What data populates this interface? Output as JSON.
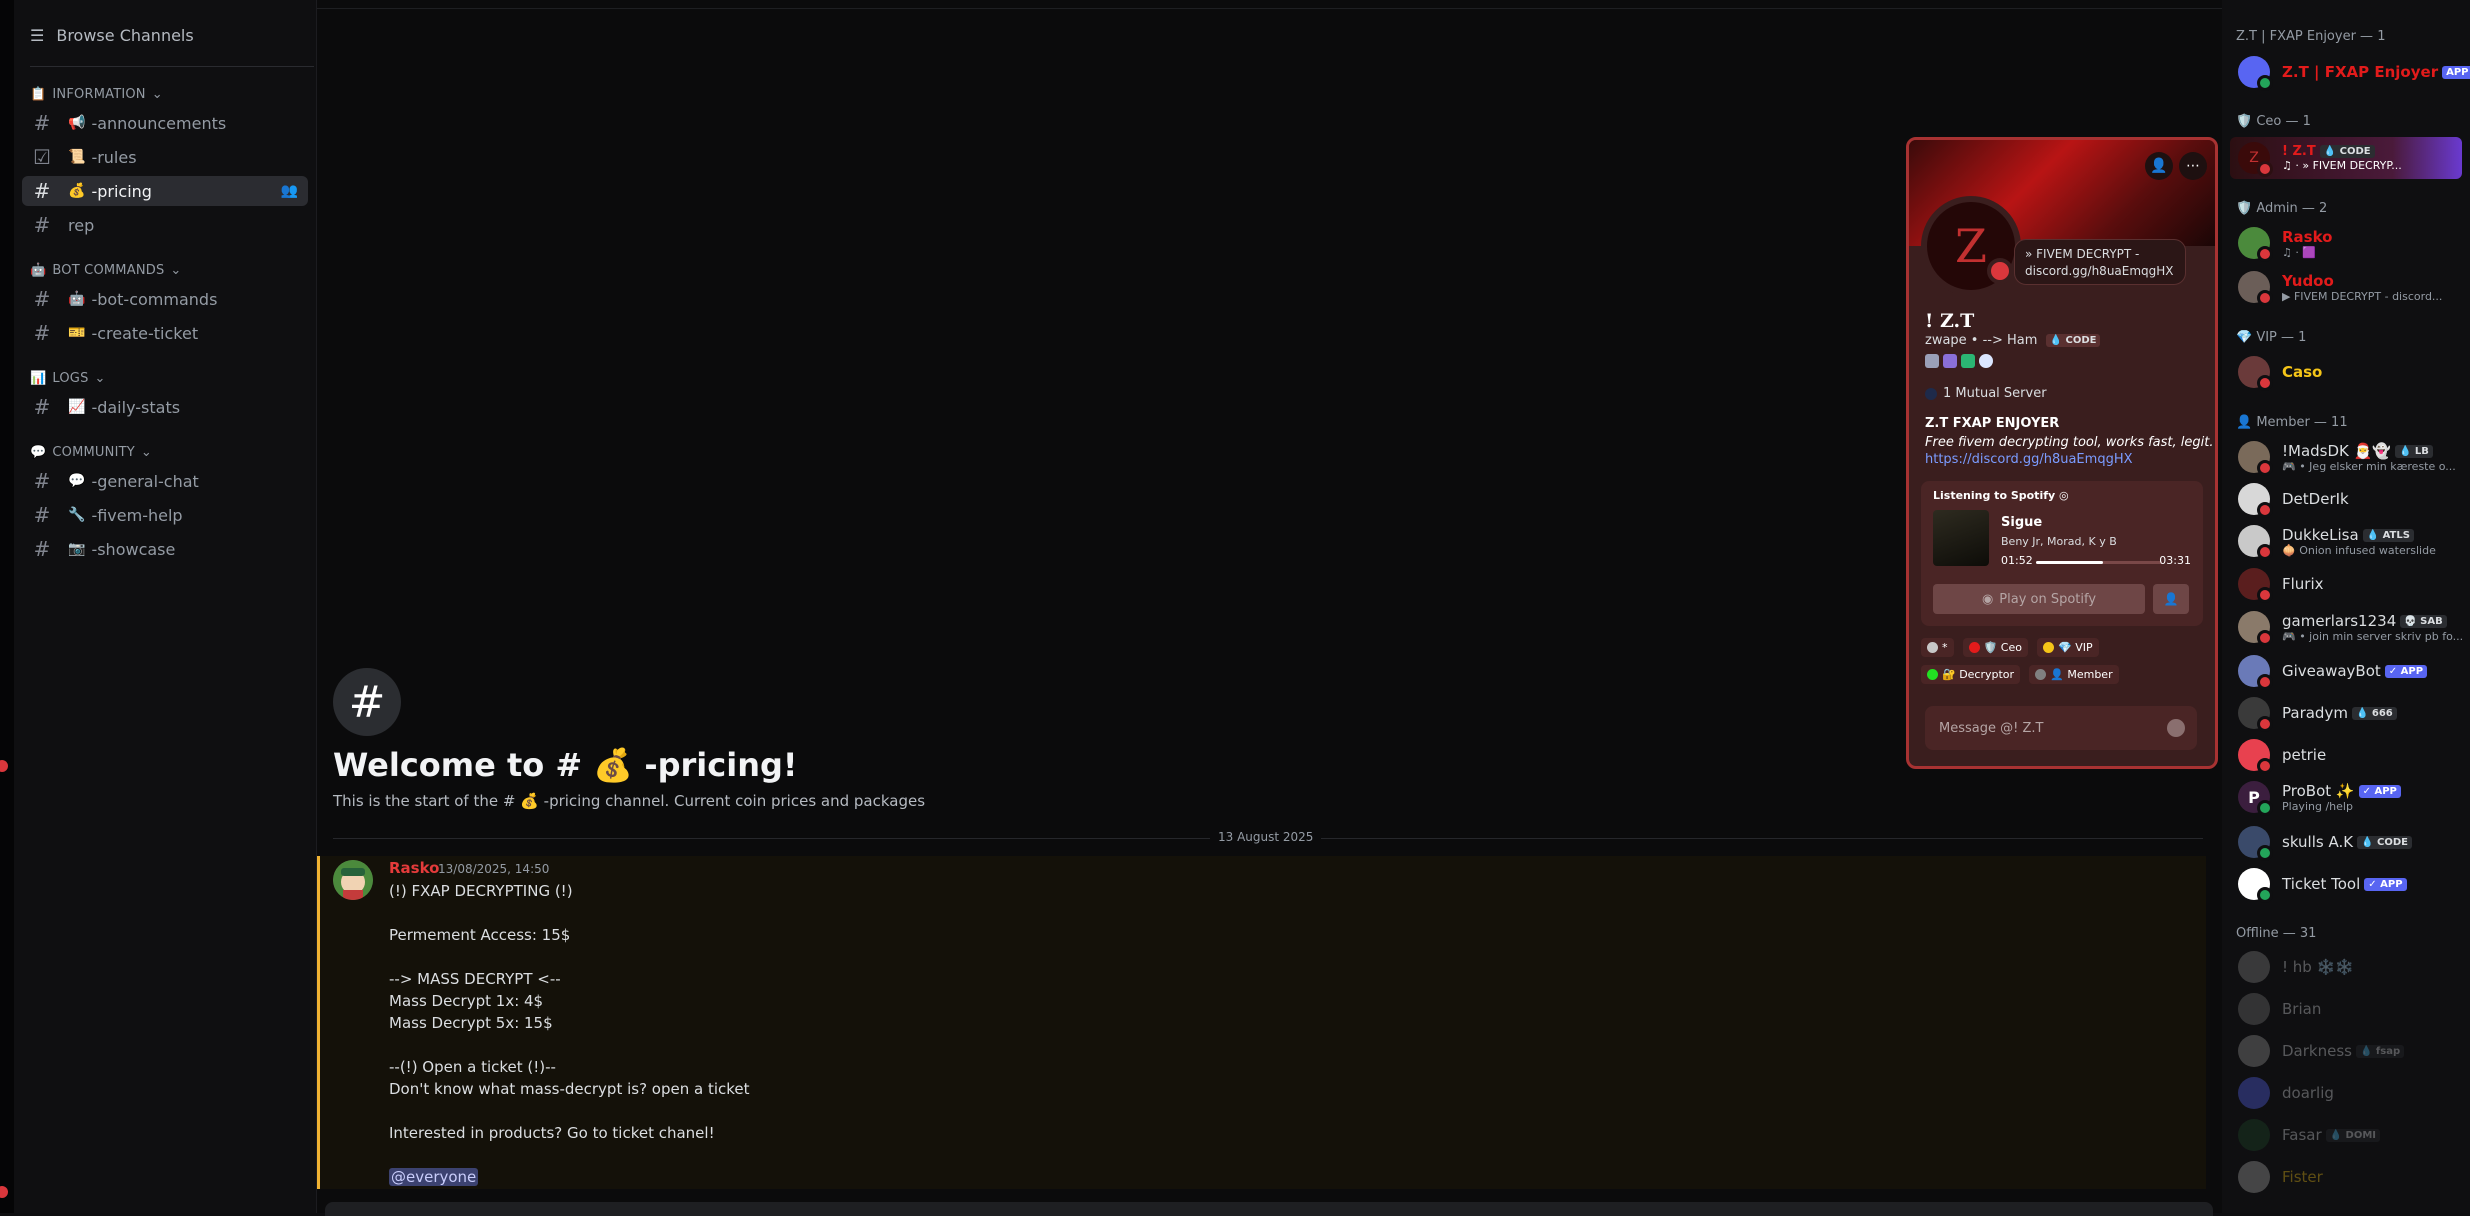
{
  "channel_sidebar": {
    "browse_label": "Browse Channels",
    "categories": [
      {
        "name": "INFORMATION",
        "emoji": "📋"
      },
      {
        "name": "BOT COMMANDS",
        "emoji": "🤖"
      },
      {
        "name": "LOGS",
        "emoji": "📊"
      },
      {
        "name": "COMMUNITY",
        "emoji": "💬"
      }
    ],
    "channels": [
      {
        "emoji": "📢",
        "name": "-announcements"
      },
      {
        "emoji": "📜",
        "name": "-rules"
      },
      {
        "emoji": "💰",
        "name": "-pricing"
      },
      {
        "emoji": "",
        "name": "rep"
      },
      {
        "emoji": "🤖",
        "name": "-bot-commands"
      },
      {
        "emoji": "🎫",
        "name": "-create-ticket"
      },
      {
        "emoji": "📈",
        "name": "-daily-stats"
      },
      {
        "emoji": "💬",
        "name": "-general-chat"
      },
      {
        "emoji": "🔧",
        "name": "-fivem-help"
      },
      {
        "emoji": "📷",
        "name": "-showcase"
      }
    ]
  },
  "main": {
    "welcome_title": "Welcome to # 💰 -pricing!",
    "welcome_sub": "This is the start of the # 💰 -pricing channel. Current coin prices and packages",
    "date_divider": "13 August 2025",
    "message": {
      "author": "Rasko",
      "timestamp": "13/08/2025, 14:50",
      "lines": [
        "(!) FXAP DECRYPTING (!)",
        "",
        "Permement Access: 15$",
        "",
        "--> MASS DECRYPT <--",
        "Mass Decrypt 1x: 4$",
        "Mass Decrypt 5x: 15$",
        "",
        "--(!) Open a ticket (!)--",
        "Don't know what mass-decrypt is? open a ticket",
        "",
        "Interested in products? Go to ticket chanel!",
        ""
      ],
      "mention": "@everyone"
    }
  },
  "profile": {
    "avatar_letter": "Z",
    "status_bubble": "» FIVEM DECRYPT - discord.gg/h8uaEmqgHX",
    "display_name": "! Z.T",
    "username": "zwape • --> Ham",
    "code_tag": "💧 CODE",
    "mutual": "1 Mutual Server",
    "bio_title": "Z.T FXAP ENJOYER",
    "bio": "Free fivem decrypting tool, works fast, legit.",
    "link": "https://discord.gg/h8uaEmqgHX",
    "spotify": {
      "header": "Listening to Spotify",
      "song": "Sigue",
      "artist": "Beny Jr, Morad, K y B",
      "elapsed": "01:52",
      "total": "03:31",
      "progress": 0.53,
      "play_label": "Play on Spotify"
    },
    "roles": [
      {
        "name": "*",
        "color": "#c7c7c7"
      },
      {
        "name": "🛡️ Ceo",
        "color": "#e21b1b"
      },
      {
        "name": "💎 VIP",
        "color": "#f5c518"
      },
      {
        "name": "🔐 Decryptor",
        "color": "#22e022"
      },
      {
        "name": "👤 Member",
        "color": "#808080"
      }
    ],
    "message_placeholder": "Message @! Z.T"
  },
  "members": {
    "groups": [
      {
        "label": "Z.T | FXAP Enjoyer — 1"
      },
      {
        "label": "🛡️ Ceo — 1"
      },
      {
        "label": "🛡️ Admin — 2"
      },
      {
        "label": "💎 VIP — 1"
      },
      {
        "label": "👤 Member — 11"
      },
      {
        "label": "Offline — 31"
      }
    ],
    "list": [
      {
        "name": "Z.T | FXAP Enjoyer",
        "sub": "",
        "badge": "APP",
        "color": "#e21b1b"
      },
      {
        "name": "! Z.T",
        "sub": "♫ · » FIVEM DECRYP...",
        "badge": "💧 CODE",
        "color": "#e21b1b"
      },
      {
        "name": "Rasko",
        "sub": "♫ · 🟪",
        "badge": "",
        "color": "#e21b1b"
      },
      {
        "name": "Yudoo",
        "sub": "▶ FIVEM DECRYPT - discord...",
        "badge": "",
        "color": "#e21b1b"
      },
      {
        "name": "Caso",
        "sub": "",
        "badge": "",
        "color": "#f5c518"
      },
      {
        "name": "!MadsDK 🎅👻",
        "sub": "🎮 • Jeg elsker min kæreste o...",
        "badge": "💧 LB",
        "color": "#dbdee1"
      },
      {
        "name": "DetDerIk",
        "sub": "",
        "badge": "",
        "color": "#dbdee1"
      },
      {
        "name": "DukkeLisa",
        "sub": "🧅 Onion infused waterslide",
        "badge": "💧 ATLS",
        "color": "#dbdee1"
      },
      {
        "name": "Flurix",
        "sub": "",
        "badge": "",
        "color": "#dbdee1"
      },
      {
        "name": "gamerlars1234",
        "sub": "🎮 • join min server skriv pb fo...",
        "badge": "💀 SAB",
        "color": "#dbdee1"
      },
      {
        "name": "GiveawayBot",
        "sub": "",
        "badge": "✓ APP",
        "color": "#dbdee1"
      },
      {
        "name": "Paradym",
        "sub": "",
        "badge": "💧 666",
        "color": "#dbdee1"
      },
      {
        "name": "petrie",
        "sub": "",
        "badge": "",
        "color": "#dbdee1"
      },
      {
        "name": "ProBot ✨",
        "sub": "Playing /help",
        "badge": "✓ APP",
        "color": "#dbdee1"
      },
      {
        "name": "skulls A.K",
        "sub": "",
        "badge": "💧 CODE",
        "color": "#dbdee1"
      },
      {
        "name": "Ticket Tool",
        "sub": "",
        "badge": "✓ APP",
        "color": "#dbdee1"
      },
      {
        "name": "! hb ❄️❄️",
        "sub": "",
        "badge": "",
        "color": "#dbdee1"
      },
      {
        "name": "Brian",
        "sub": "",
        "badge": "",
        "color": "#dbdee1"
      },
      {
        "name": "Darkness",
        "sub": "",
        "badge": "💧 fsap",
        "color": "#dbdee1"
      },
      {
        "name": "doarlig",
        "sub": "",
        "badge": "",
        "color": "#dbdee1"
      },
      {
        "name": "Fasar",
        "sub": "",
        "badge": "💧 DOMI",
        "color": "#dbdee1"
      },
      {
        "name": "Fister",
        "sub": "",
        "badge": "",
        "color": "#f5c518"
      }
    ]
  }
}
